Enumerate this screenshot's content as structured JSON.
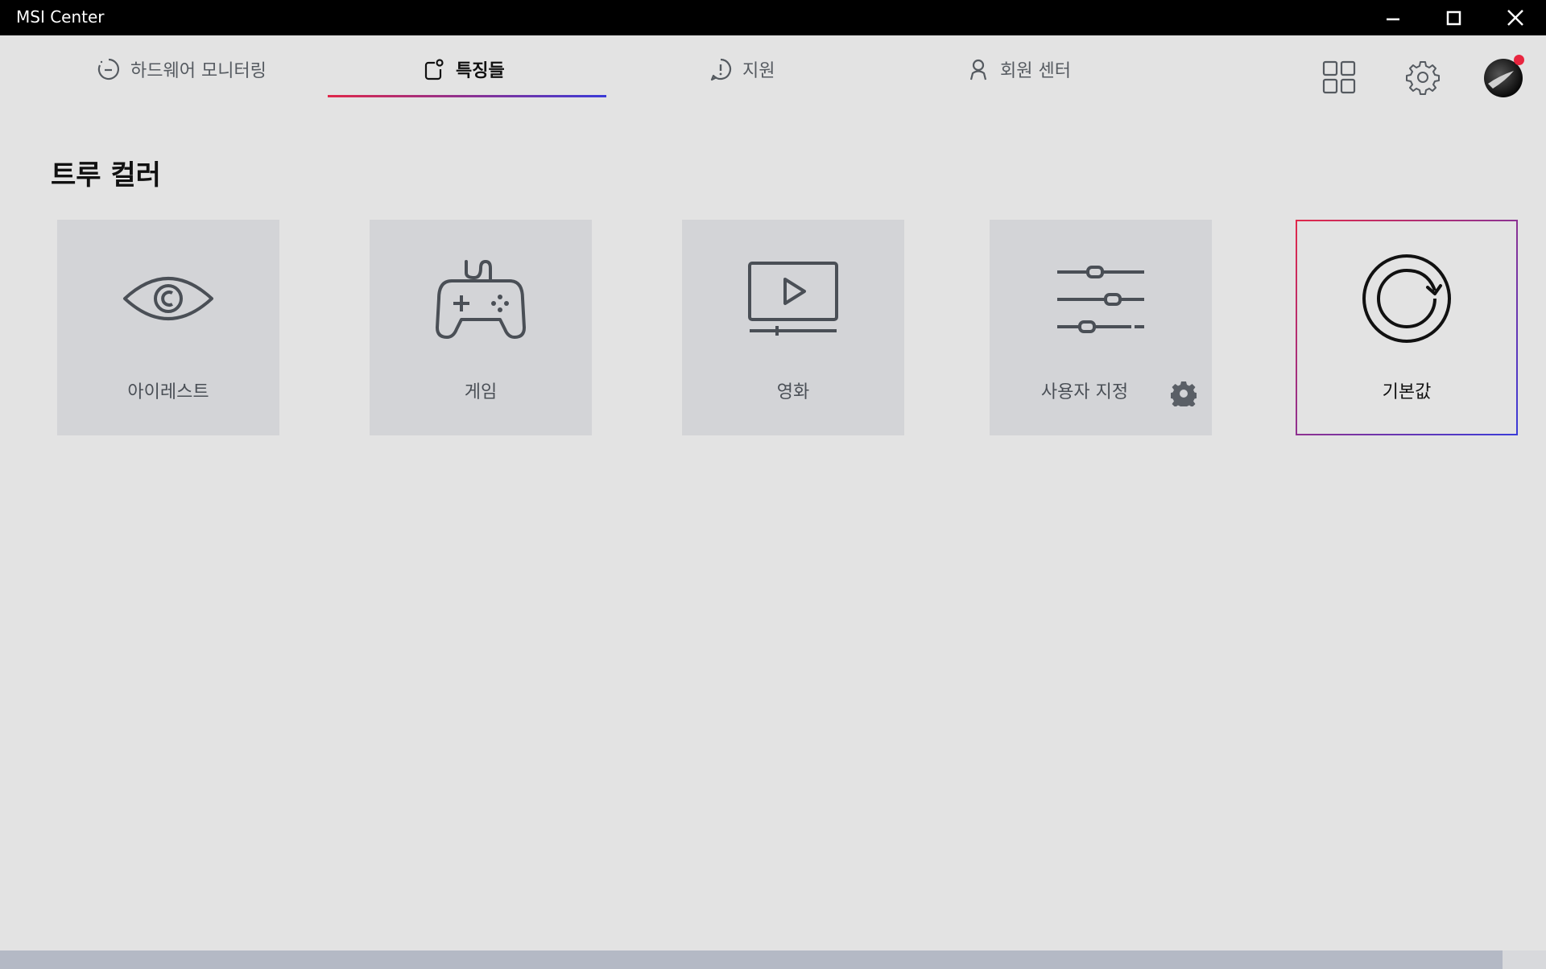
{
  "window": {
    "title": "MSI Center"
  },
  "nav": {
    "tabs": [
      {
        "label": "하드웨어 모니터링",
        "icon": "gauge-icon",
        "active": false
      },
      {
        "label": "특징들",
        "icon": "features-icon",
        "active": true
      },
      {
        "label": "지원",
        "icon": "support-alert-icon",
        "active": false
      },
      {
        "label": "회원 센터",
        "icon": "user-icon",
        "active": false
      }
    ],
    "right_icons": [
      "apps-grid-icon",
      "settings-gear-icon",
      "avatar"
    ]
  },
  "section": {
    "title": "트루 컬러"
  },
  "modes": [
    {
      "label": "아이레스트",
      "icon": "eye-icon",
      "selected": false
    },
    {
      "label": "게임",
      "icon": "gamepad-icon",
      "selected": false
    },
    {
      "label": "영화",
      "icon": "movie-play-icon",
      "selected": false
    },
    {
      "label": "사용자 지정",
      "icon": "sliders-icon",
      "selected": false,
      "has_settings": true
    },
    {
      "label": "기본값",
      "icon": "refresh-icon",
      "selected": true
    }
  ],
  "colors": {
    "accent_start": "#e0284a",
    "accent_end": "#3b3bd8",
    "titlebar": "#000000",
    "background": "#e3e3e3",
    "card": "#d3d4d7",
    "notification_dot": "#e8253f"
  }
}
